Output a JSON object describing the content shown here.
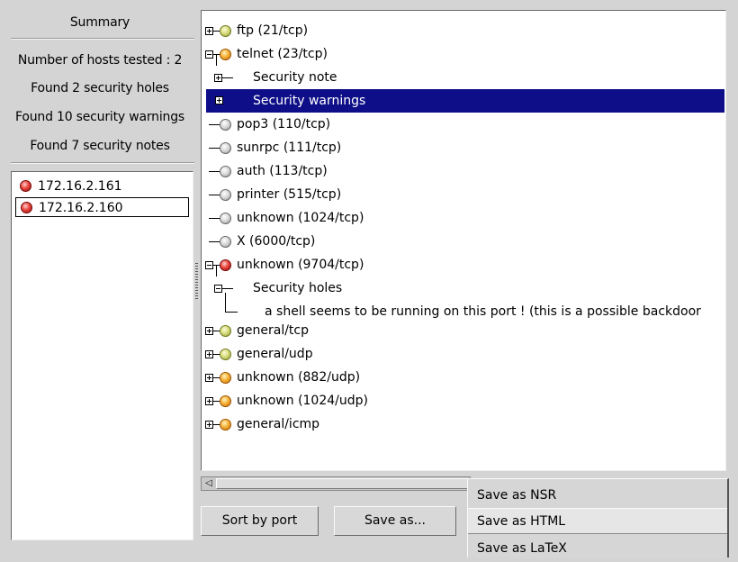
{
  "summary": {
    "title": "Summary",
    "hosts_tested": "Number of hosts tested : 2",
    "holes": "Found 2 security holes",
    "warnings": "Found 10 security warnings",
    "notes": "Found 7 security notes"
  },
  "hosts": [
    {
      "ip": "172.16.2.161",
      "status": "red"
    },
    {
      "ip": "172.16.2.160",
      "status": "red",
      "selected": true
    }
  ],
  "tree": {
    "ftp": "ftp (21/tcp)",
    "telnet": "telnet (23/tcp)",
    "security_note": "Security note",
    "security_warnings": "Security warnings",
    "pop3": "pop3 (110/tcp)",
    "sunrpc": "sunrpc (111/tcp)",
    "auth": "auth (113/tcp)",
    "printer": "printer (515/tcp)",
    "unknown_1024_tcp": "unknown (1024/tcp)",
    "x11": "X (6000/tcp)",
    "unknown_9704": "unknown (9704/tcp)",
    "security_holes": "Security holes",
    "backdoor_msg": "a shell seems to be running on this port ! (this is a possible backdoor",
    "general_tcp": "general/tcp",
    "general_udp": "general/udp",
    "unknown_882": "unknown (882/udp)",
    "unknown_1024_udp": "unknown (1024/udp)",
    "general_icmp": "general/icmp"
  },
  "buttons": {
    "sort": "Sort by port",
    "save_as": "Save as..."
  },
  "menu": {
    "nsr": "Save as NSR",
    "html": "Save as HTML",
    "latex": "Save as LaTeX"
  },
  "colors": {
    "selection": "#0e0e88",
    "hole": "#e8453c",
    "warning": "#f6b238",
    "note": "#d9dc7e",
    "ok": "#d6d6d6"
  }
}
